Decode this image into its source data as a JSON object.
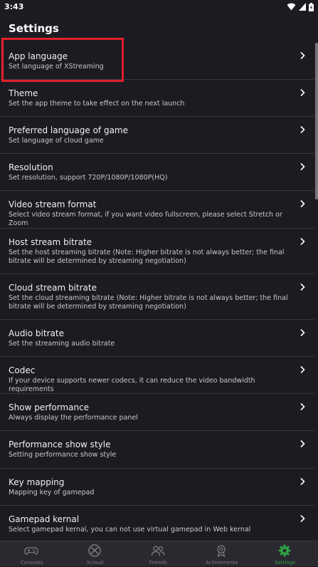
{
  "status_bar": {
    "time": "3:43"
  },
  "header": {
    "title": "Settings"
  },
  "settings": [
    {
      "title": "App language",
      "desc": "Set language of XStreaming"
    },
    {
      "title": "Theme",
      "desc": "Set the app theme to take effect on the next launch"
    },
    {
      "title": "Preferred language of game",
      "desc": "Set language of cloud game"
    },
    {
      "title": "Resolution",
      "desc": "Set resolution, support 720P/1080P/1080P(HQ)"
    },
    {
      "title": "Video stream format",
      "desc": "Select video stream format, if you want video fullscreen, please select Stretch or Zoom"
    },
    {
      "title": "Host stream bitrate",
      "desc": "Set the host streaming bitrate (Note: Higher bitrate is not always better; the final bitrate will be determined by streaming negotiation)"
    },
    {
      "title": "Cloud stream bitrate",
      "desc": "Set the cloud streaming bitrate (Note: Higher bitrate is not always better; the final bitrate will be determined by streaming negotiation)"
    },
    {
      "title": "Audio bitrate",
      "desc": "Set the streaming audio bitrate"
    },
    {
      "title": "Codec",
      "desc": "If your device supports newer codecs, it can reduce the video bandwidth requirements"
    },
    {
      "title": "Show performance",
      "desc": "Always display the performance panel"
    },
    {
      "title": "Performance show style",
      "desc": "Setting performance show style"
    },
    {
      "title": "Key mapping",
      "desc": "Mapping key of gamepad"
    },
    {
      "title": "Gamepad kernal",
      "desc": "Select gamepad kernal, you can not use virtual gamepad in Web kernal"
    }
  ],
  "nav": [
    {
      "label": "Consoles",
      "icon": "gamepad-icon"
    },
    {
      "label": "Xcloud",
      "icon": "xbox-icon"
    },
    {
      "label": "Friends",
      "icon": "friends-icon"
    },
    {
      "label": "Achivements",
      "icon": "achievement-icon"
    },
    {
      "label": "Settings",
      "icon": "gear-icon",
      "active": true
    }
  ],
  "colors": {
    "background": "#1c1b21",
    "accent": "#2ea043",
    "highlight": "#e3202b",
    "nav_bg": "#2a2930"
  }
}
